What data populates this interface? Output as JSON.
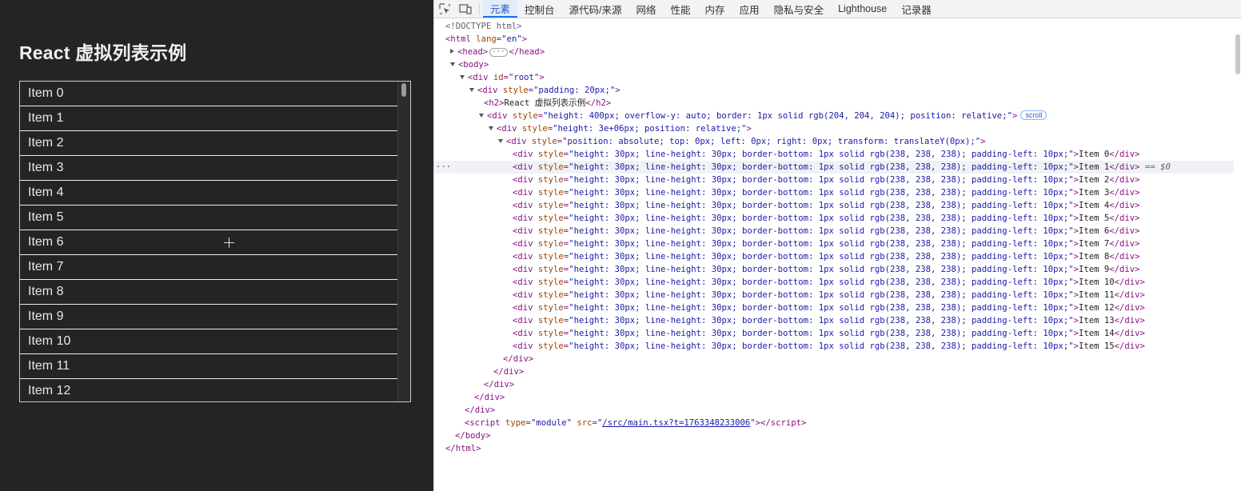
{
  "page": {
    "title": "React 虚拟列表示例",
    "items": [
      "Item 0",
      "Item 1",
      "Item 2",
      "Item 3",
      "Item 4",
      "Item 5",
      "Item 6",
      "Item 7",
      "Item 8",
      "Item 9",
      "Item 10",
      "Item 11",
      "Item 12"
    ]
  },
  "devtools": {
    "tabs": [
      "元素",
      "控制台",
      "源代码/来源",
      "网络",
      "性能",
      "内存",
      "应用",
      "隐私与安全",
      "Lighthouse",
      "记录器"
    ],
    "active_tab": "元素",
    "scroll_badge": "scroll",
    "selected_marker": "== $0",
    "script_src": "/src/main.tsx?t=1763348233006",
    "row_style": "height: 30px; line-height: 30px; border-bottom: 1px solid rgb(238, 238, 238); padding-left: 10px;",
    "dom_rows": [
      "Item 0",
      "Item 1",
      "Item 2",
      "Item 3",
      "Item 4",
      "Item 5",
      "Item 6",
      "Item 7",
      "Item 8",
      "Item 9",
      "Item 10",
      "Item 11",
      "Item 12",
      "Item 13",
      "Item 14",
      "Item 15"
    ],
    "selected_index": 1
  },
  "colors": {
    "page_bg": "#242424",
    "devtools_bg": "#ffffff",
    "active_tab": "#1a73e8",
    "tag": "#881280",
    "attr_name": "#994500",
    "attr_value": "#1a1aa6"
  },
  "icons": [
    "inspect-element-icon",
    "device-toggle-icon",
    "expand-triangle-icon",
    "collapse-triangle-icon"
  ]
}
